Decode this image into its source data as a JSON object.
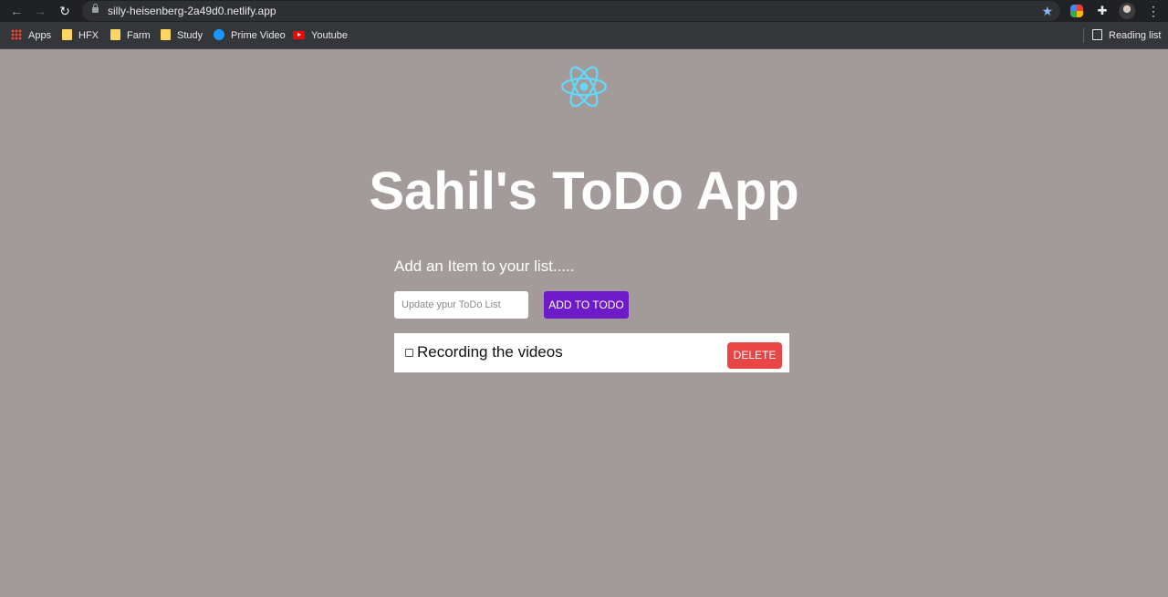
{
  "browser": {
    "url": "silly-heisenberg-2a49d0.netlify.app",
    "nav": {
      "back_icon": "←",
      "forward_icon": "→",
      "reload_icon": "↻"
    },
    "star_icon": "★",
    "puzzle_icon": "✚",
    "menu_icon": "⋮"
  },
  "bookmarks": {
    "items": [
      {
        "label": "Apps",
        "icon": "apps-grid-icon"
      },
      {
        "label": "HFX",
        "icon": "folder-icon"
      },
      {
        "label": "Farm",
        "icon": "folder-icon"
      },
      {
        "label": "Study",
        "icon": "folder-icon"
      },
      {
        "label": "Prime Video",
        "icon": "prime-video-icon"
      },
      {
        "label": "Youtube",
        "icon": "youtube-icon"
      }
    ],
    "reading_list": "Reading list"
  },
  "app": {
    "logo": "react-logo-icon",
    "title": "Sahil's ToDo App",
    "subtitle": "Add an Item to your list.....",
    "input": {
      "placeholder": "Update ypur ToDo List",
      "value": ""
    },
    "add_button": "ADD TO TODO",
    "todos": [
      {
        "text": "Recording the videos",
        "checked": false,
        "delete_label": "DELETE"
      }
    ]
  },
  "colors": {
    "page_background": "#a39a9a",
    "add_button": "#6d1bc9",
    "delete_button": "#e84545",
    "react_logo": "#61dafb"
  }
}
